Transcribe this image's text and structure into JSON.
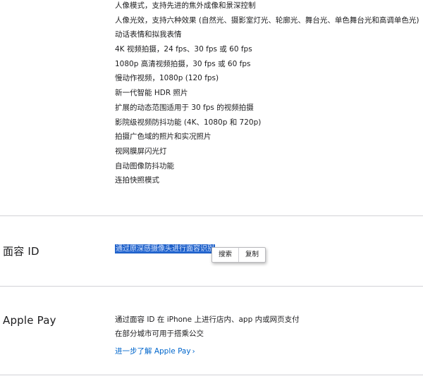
{
  "camera": {
    "features": [
      "人像模式，支持先进的焦外成像和景深控制",
      "人像光效，支持六种效果 (自然光、摄影室灯光、轮廓光、舞台光、单色舞台光和高调单色光)",
      "动话表情和拟我表情",
      "4K 视频拍摄，24 fps、30 fps 或 60 fps",
      "1080p 高清视频拍摄，30 fps 或 60 fps",
      "慢动作视频，1080p (120 fps)",
      "新一代智能 HDR 照片",
      "扩展的动态范围适用于 30 fps 的视频拍摄",
      "影院级视频防抖功能 (4K、1080p 和 720p)",
      "拍摄广色域的照片和实况照片",
      "视网膜屏闪光灯",
      "自动图像防抖功能",
      "连拍快照模式"
    ]
  },
  "face_id": {
    "title": "面容 ID",
    "selected_text": "通过原深感摄像头进行面容识别",
    "context_menu": {
      "search": "搜索",
      "copy": "复制"
    }
  },
  "apple_pay": {
    "title": "Apple Pay",
    "lines": [
      "通过面容 ID 在 iPhone 上进行店内、app 内或网页支付",
      "在部分城市可用于搭乘公交"
    ],
    "learn_more": "进一步了解 Apple Pay",
    "learn_more_chevron": "›"
  },
  "colors": {
    "link": "#0066cc",
    "selection": "#1e60c8",
    "divider": "#d2d2d7"
  }
}
